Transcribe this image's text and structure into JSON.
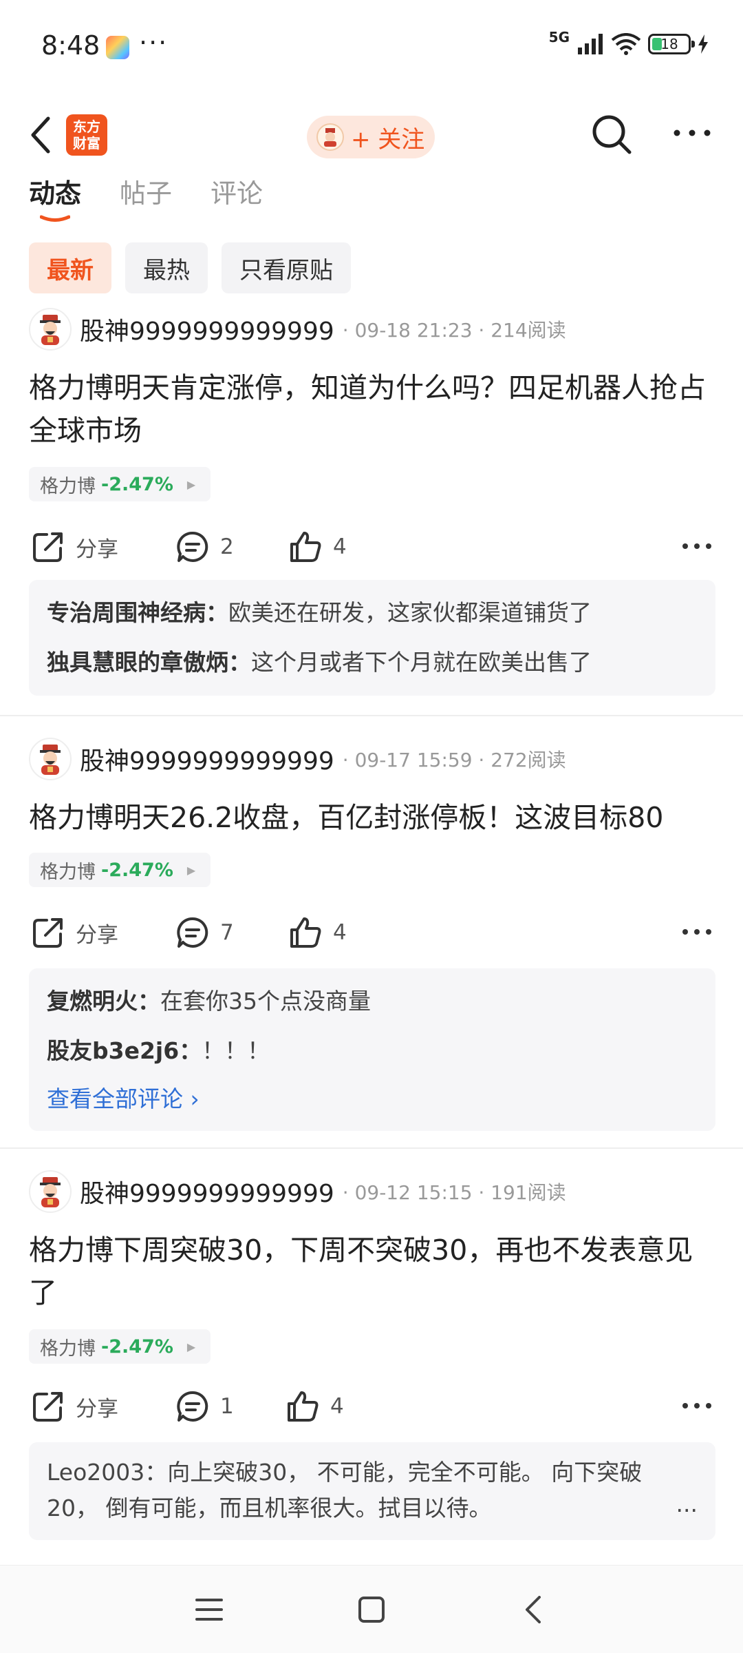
{
  "status_bar": {
    "time": "8:48",
    "network": "5G",
    "battery": "18"
  },
  "header": {
    "logo_line1": "东方",
    "logo_line2": "财富",
    "follow_label": "+ 关注"
  },
  "tabs": [
    {
      "label": "动态"
    },
    {
      "label": "帖子"
    },
    {
      "label": "评论"
    }
  ],
  "filters": [
    {
      "label": "最新"
    },
    {
      "label": "最热"
    },
    {
      "label": "只看原贴"
    }
  ],
  "colors": {
    "accent": "#f0541e",
    "stock_down": "#2bab5b",
    "link": "#2f6fd6"
  },
  "posts": [
    {
      "author": "股神9999999999999",
      "meta": "· 09-18 21:23 · 214阅读",
      "text": "格力博明天肯定涨停，知道为什么吗？四足机器人抢占全球市场",
      "stock": {
        "name": "格力博",
        "change": "-2.47%"
      },
      "share_label": "分享",
      "comment_count": "2",
      "like_count": "4",
      "comments": [
        {
          "author": "专治周围神经病：",
          "text": "欧美还在研发，这家伙都渠道铺货了"
        },
        {
          "author": "独具慧眼的章傲炳：",
          "text": "这个月或者下个月就在欧美出售了"
        }
      ]
    },
    {
      "author": "股神9999999999999",
      "meta": "· 09-17 15:59 · 272阅读",
      "text": "格力博明天26.2收盘，百亿封涨停板！这波目标80",
      "stock": {
        "name": "格力博",
        "change": "-2.47%"
      },
      "share_label": "分享",
      "comment_count": "7",
      "like_count": "4",
      "comments": [
        {
          "author": "复燃明火：",
          "text": "在套你35个点没商量"
        },
        {
          "author": "股友b3e2j6：",
          "text": "！！！"
        }
      ],
      "view_all": "查看全部评论 ›"
    },
    {
      "author": "股神9999999999999",
      "meta": "· 09-12 15:15 · 191阅读",
      "text": "格力博下周突破30，下周不突破30，再也不发表意见了",
      "stock": {
        "name": "格力博",
        "change": "-2.47%"
      },
      "share_label": "分享",
      "comment_count": "1",
      "like_count": "4",
      "comments": [
        {
          "author": "Leo2003：",
          "text": "向上突破30， 不可能，完全不可能。 向下突破20， 倒有可能，而且机率很大。拭目以待。"
        }
      ],
      "ellipsis": "..."
    }
  ]
}
